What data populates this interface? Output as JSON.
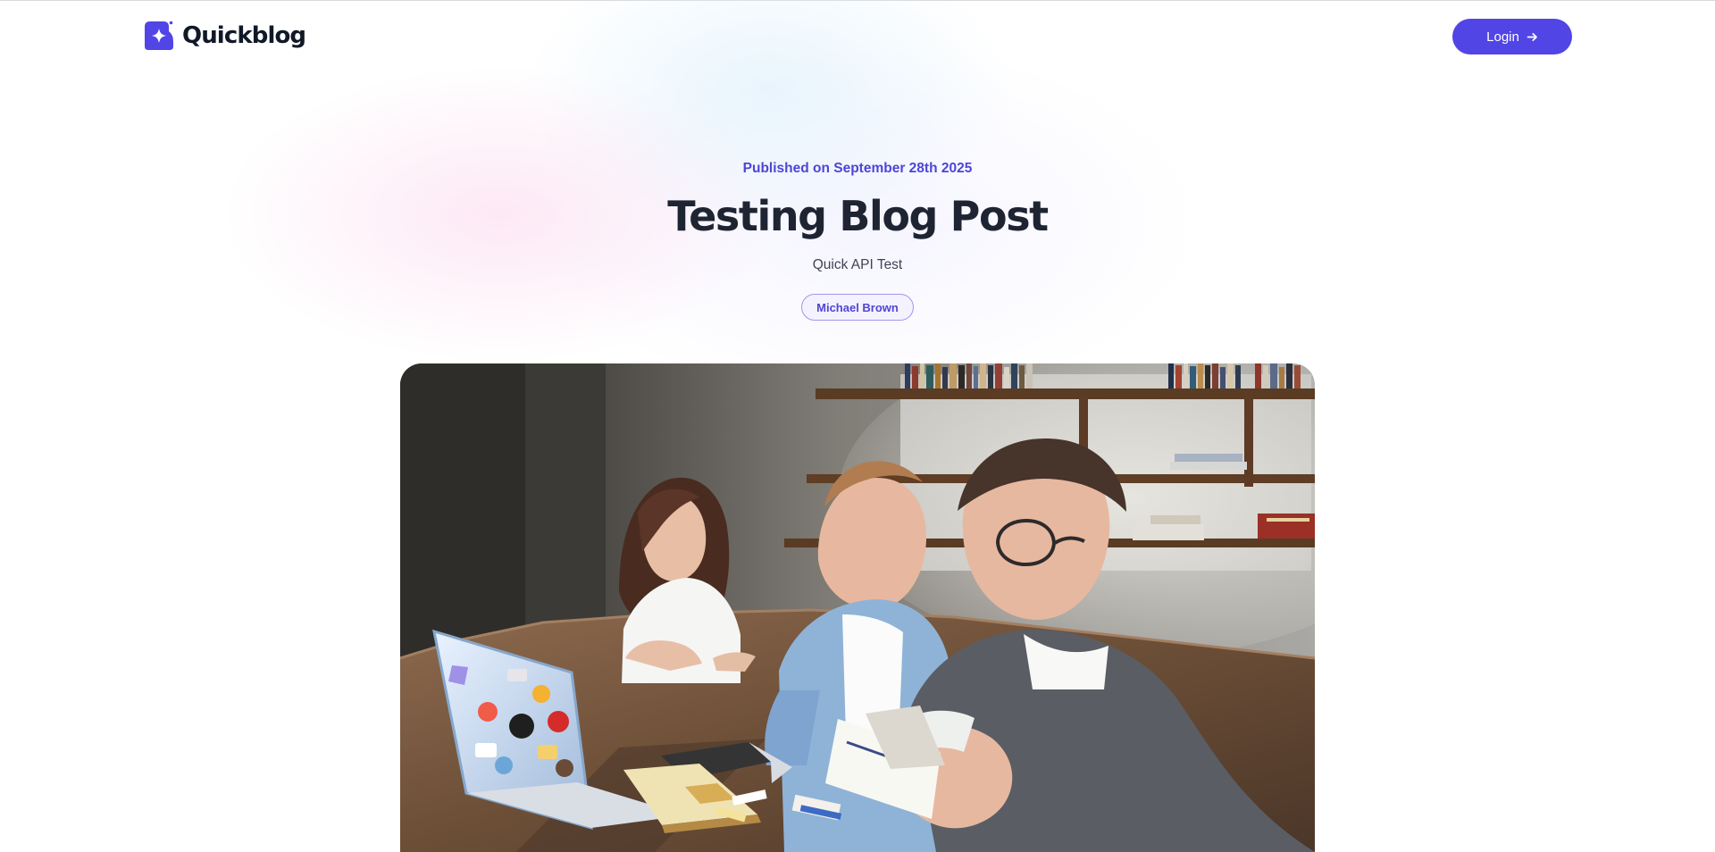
{
  "header": {
    "brand": "Quickblog",
    "logo_icon": "sparkle-logo-icon",
    "login_label": "Login",
    "login_icon": "arrow-right-icon",
    "accent_color": "#5145e5"
  },
  "post": {
    "published": "Published on September 28th 2025",
    "title": "Testing Blog Post",
    "subtitle": "Quick API Test",
    "author": "Michael Brown"
  },
  "hero_image": {
    "subject": "three people studying at a wooden table with a sticker-covered laptop, books and shelves"
  }
}
